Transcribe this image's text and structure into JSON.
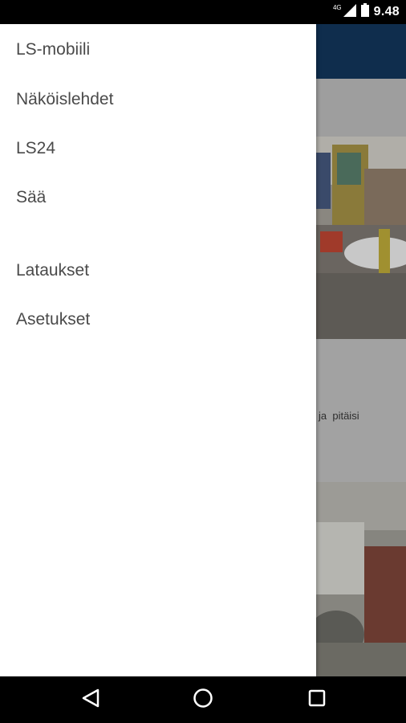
{
  "status_bar": {
    "network": "4G",
    "time": "9.48",
    "icons": [
      "signal-icon",
      "battery-icon"
    ]
  },
  "background_app": {
    "snippet": "ja  pitäisi",
    "toolbar_color": "#0f2d4d"
  },
  "drawer": {
    "items": [
      {
        "label": "LS-mobiili"
      },
      {
        "label": "Näköislehdet"
      },
      {
        "label": "LS24"
      },
      {
        "label": "Sää"
      },
      {
        "label": "Lataukset"
      },
      {
        "label": "Asetukset"
      }
    ]
  },
  "nav_bar": {
    "buttons": [
      "back-icon",
      "home-icon",
      "recents-icon"
    ]
  }
}
